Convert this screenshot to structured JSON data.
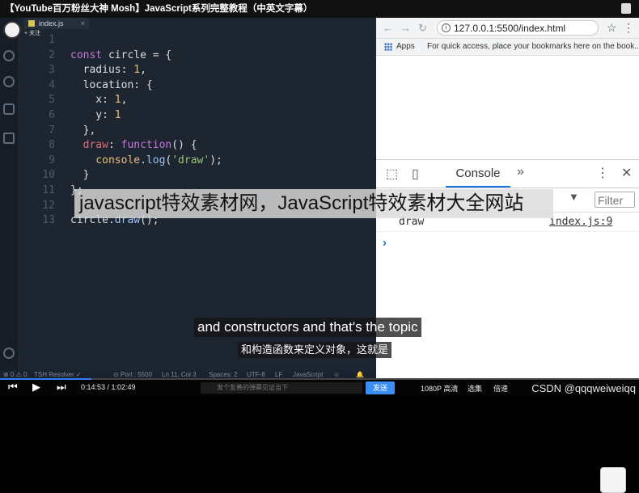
{
  "video": {
    "title": "【YouTube百万粉丝大神 Mosh】JavaScript系列完整教程（中英文字幕）",
    "follow_label": "+ 关注"
  },
  "editor": {
    "tab_label": "index.js",
    "tab_close": "×",
    "lines": [
      {
        "n": "1",
        "parts": []
      },
      {
        "n": "2",
        "parts": [
          {
            "t": "const ",
            "c": "kw"
          },
          {
            "t": "circle = {",
            "c": "plain"
          }
        ]
      },
      {
        "n": "3",
        "parts": [
          {
            "t": "  radius: ",
            "c": "plain"
          },
          {
            "t": "1",
            "c": "num"
          },
          {
            "t": ",",
            "c": "plain"
          }
        ]
      },
      {
        "n": "4",
        "parts": [
          {
            "t": "  location: {",
            "c": "plain"
          }
        ]
      },
      {
        "n": "5",
        "parts": [
          {
            "t": "    x: ",
            "c": "plain"
          },
          {
            "t": "1",
            "c": "num"
          },
          {
            "t": ",",
            "c": "plain"
          }
        ]
      },
      {
        "n": "6",
        "parts": [
          {
            "t": "    y: ",
            "c": "plain"
          },
          {
            "t": "1",
            "c": "num"
          }
        ]
      },
      {
        "n": "7",
        "parts": [
          {
            "t": "  },",
            "c": "plain"
          }
        ]
      },
      {
        "n": "8",
        "parts": [
          {
            "t": "  draw",
            "c": "prop"
          },
          {
            "t": ": ",
            "c": "plain"
          },
          {
            "t": "function",
            "c": "kw"
          },
          {
            "t": "() {",
            "c": "plain"
          }
        ]
      },
      {
        "n": "9",
        "parts": [
          {
            "t": "    console",
            "c": "num"
          },
          {
            "t": ".",
            "c": "plain"
          },
          {
            "t": "log",
            "c": "fn"
          },
          {
            "t": "(",
            "c": "plain"
          },
          {
            "t": "'draw'",
            "c": "str"
          },
          {
            "t": ");",
            "c": "plain"
          }
        ]
      },
      {
        "n": "10",
        "parts": [
          {
            "t": "  }",
            "c": "plain"
          }
        ]
      },
      {
        "n": "11",
        "parts": [
          {
            "t": "};",
            "c": "plain"
          }
        ]
      },
      {
        "n": "12",
        "parts": []
      },
      {
        "n": "13",
        "parts": [
          {
            "t": "circle.",
            "c": "plain"
          },
          {
            "t": "draw",
            "c": "fn"
          },
          {
            "t": "();",
            "c": "plain"
          }
        ]
      }
    ],
    "status_items": [
      "⊗ 0  ⚠ 0",
      "TSH Resolver ✓",
      "⊙ Port : 5500",
      "Ln 11, Col 3",
      "Spaces: 2",
      "UTF-8",
      "LF",
      "JavaScript",
      "☺",
      "🔔"
    ]
  },
  "browser": {
    "url": "127.0.0.1:5500/index.html",
    "apps_label": "Apps",
    "bookmarks_hint": "For quick access, place your bookmarks here on the book...",
    "devtools": {
      "console_tab": "Console",
      "filter_placeholder": "Filter",
      "log_text": "draw",
      "log_source": "index.js:9",
      "prompt": "›"
    }
  },
  "overlay": {
    "watermark": "javascript特效素材网，JavaScript特效素材大全网站",
    "subtitle_en": "and constructors and that's the topic",
    "subtitle_cn": "和构造函数来定义对象，这就是"
  },
  "player": {
    "progress": 0.1426,
    "time": "0:14:53 / 1:02:49",
    "danmu_placeholder": "发个友善的弹幕见证当下",
    "send_label": "发送",
    "quality": "1080P 高清",
    "episodes": "选集",
    "speed": "倍速",
    "source": "CSDN @qqqweiweiqq"
  }
}
